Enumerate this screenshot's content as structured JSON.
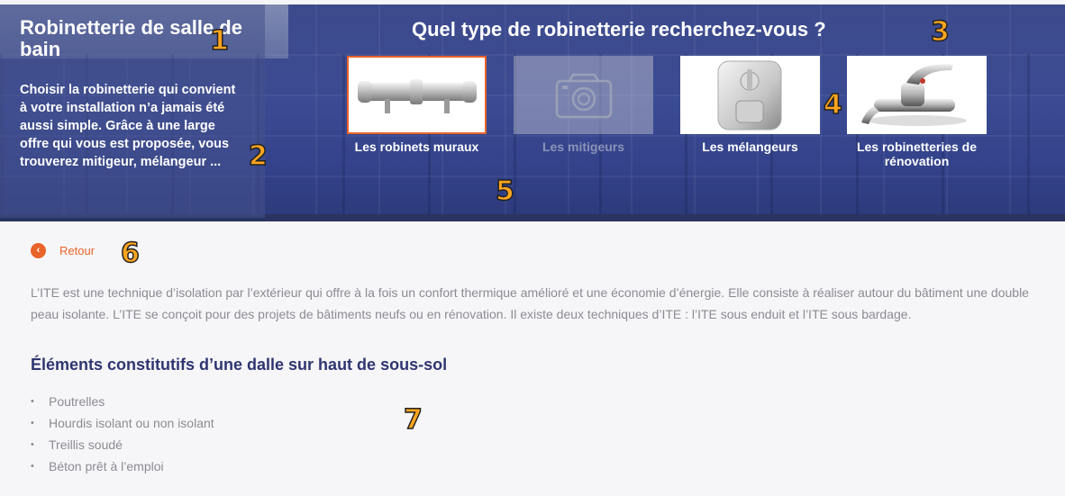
{
  "hero": {
    "title": "Robinetterie de salle de bain",
    "description": "Choisir la robinetterie qui convient à votre installation n’a jamais été aussi simple. Grâce à une large offre qui vous est proposée, vous trouverez mitigeur, mélangeur ...",
    "question": "Quel type de robinetterie recherchez-vous ?",
    "cards": [
      {
        "label": "Les robinets muraux",
        "state": "selected",
        "image": "thermostatic-shower-valve"
      },
      {
        "label": "Les mitigeurs",
        "state": "disabled",
        "image": "camera-placeholder-icon"
      },
      {
        "label": "Les mélangeurs",
        "state": "normal",
        "image": "concealed-mixer-valve"
      },
      {
        "label": "Les robinetteries de rénovation",
        "state": "normal",
        "image": "wall-mixer-tap"
      }
    ]
  },
  "markers": [
    "1",
    "2",
    "3",
    "4",
    "5",
    "6",
    "7"
  ],
  "back": {
    "label": "Retour"
  },
  "content": {
    "paragraph": "L’ITE est une technique d’isolation par l’extérieur qui offre à la fois un confort thermique amélioré et une économie d’énergie. Elle consiste à réaliser autour du bâtiment une double peau isolante. L’ITE se conçoit pour des projets de bâtiments neufs ou en rénovation. Il existe deux techniques d’ITE : l’ITE sous enduit et l’ITE sous bardage.",
    "subheading": "Éléments constitutifs d’une dalle sur haut de sous-sol",
    "items": [
      "Poutrelles",
      "Hourdis isolant ou non isolant",
      "Treillis soudé",
      "Béton prêt à l’emploi"
    ]
  },
  "colors": {
    "accent": "#e9632a",
    "heading": "#2f3570",
    "hero": "#3b4b93"
  }
}
